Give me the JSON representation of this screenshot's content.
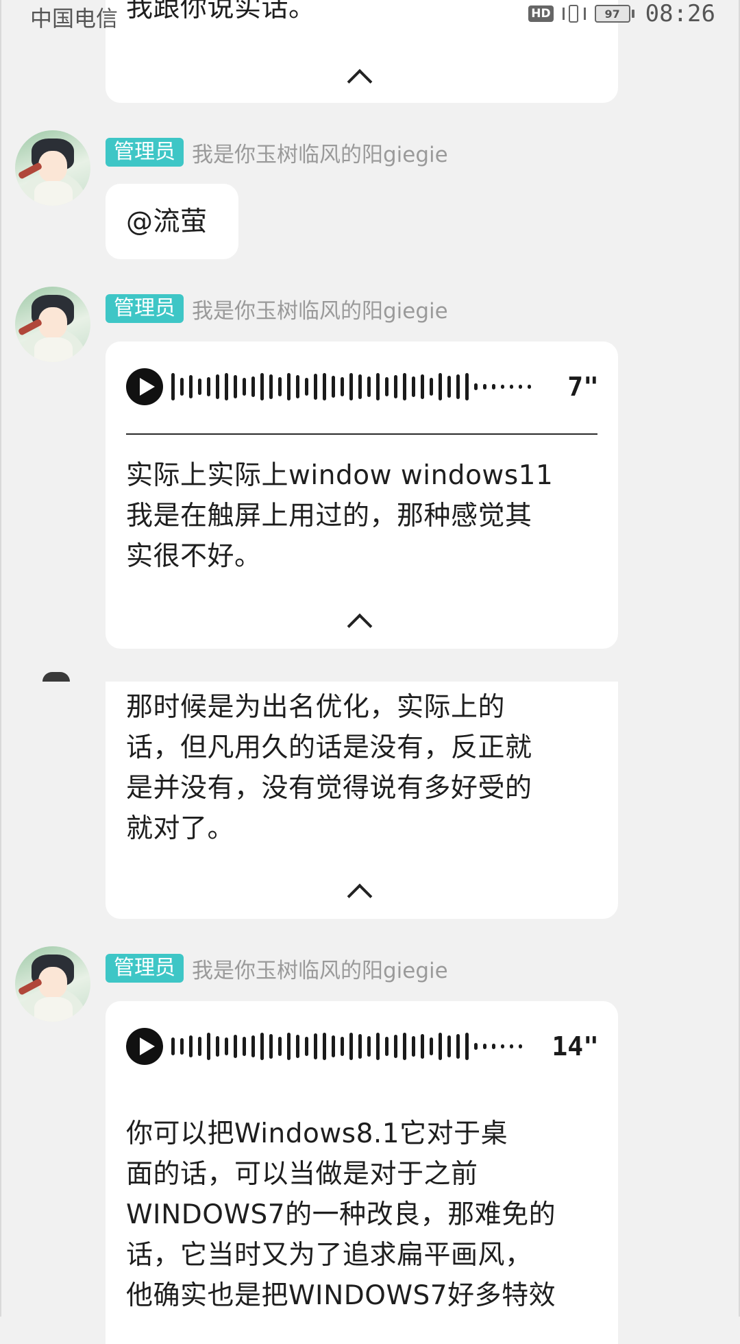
{
  "status_bar": {
    "carrier": "中国电信",
    "hd": "HD",
    "battery": "97",
    "time": "08:26"
  },
  "messages": [
    {
      "text_lines": [
        "我跟你说实话。"
      ],
      "collapse_icon": "chevron-up-icon"
    },
    {
      "admin_badge": "管理员",
      "sender": "我是你玉树临风的阳giegie",
      "text": "@流萤"
    },
    {
      "admin_badge": "管理员",
      "sender": "我是你玉树临风的阳giegie",
      "voice_duration": "7\"",
      "transcript_lines": [
        "实际上实际上window windows11",
        "我是在触屏上用过的，那种感觉其",
        "实很不好。"
      ],
      "collapse_icon": "chevron-up-icon"
    },
    {
      "text_lines": [
        "那时候是为出名优化，实际上的",
        "话，但凡用久的话是没有，反正就",
        "是并没有，没有觉得说有多好受的",
        "就对了。"
      ],
      "collapse_icon": "chevron-up-icon"
    },
    {
      "admin_badge": "管理员",
      "sender": "我是你玉树临风的阳giegie",
      "voice_duration": "14\"",
      "transcript_lines": [
        "你可以把Windows8.1它对于桌",
        "面的话，可以当做是对于之前",
        "WINDOWS7的一种改良，那难免的",
        "话，它当时又为了追求扁平画风，",
        "他确实也是把WINDOWS7好多特效"
      ]
    }
  ]
}
